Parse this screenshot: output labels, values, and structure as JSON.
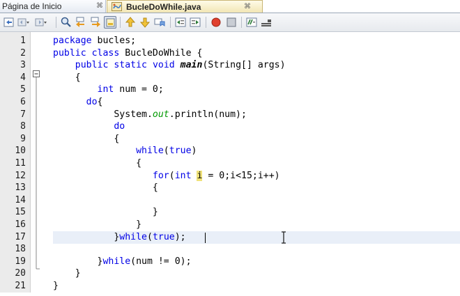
{
  "tabs": [
    {
      "label": "Página de Inicio",
      "active": false
    },
    {
      "label": "BucleDoWhile.java",
      "active": true
    }
  ],
  "tab_close_glyph": "⌘",
  "toolbar": {
    "icons": [
      "back-history-icon",
      "back-dropdown-icon",
      "forward-history-icon",
      "forward-dropdown-icon",
      "find-selection-icon",
      "find-previous-icon",
      "find-next-icon",
      "toggle-highlight-icon",
      "previous-bookmark-icon",
      "next-bookmark-icon",
      "toggle-bookmark-icon",
      "shift-left-icon",
      "shift-right-icon",
      "start-macro-icon",
      "stop-macro-icon",
      "comment-icon",
      "uncomment-icon"
    ]
  },
  "colors": {
    "keyword": "#0000e6",
    "field": "#009900",
    "occurrence_highlight": "#f0e27a",
    "current_line": "#e9eff8"
  },
  "editor": {
    "line_numbers": [
      "1",
      "2",
      "3",
      "4",
      "5",
      "6",
      "7",
      "8",
      "9",
      "10",
      "11",
      "12",
      "13",
      "14",
      "15",
      "16",
      "17",
      "18",
      "19",
      "20",
      "21"
    ],
    "current_line": 17,
    "lines": [
      "package bucles;",
      "public class BucleDoWhile {",
      "    public static void main(String[] args)",
      "    {",
      "        int num = 0;",
      "      do{",
      "           System.out.println(num);",
      "           do",
      "           {",
      "               while(true)",
      "               {",
      "                  for(int i = 0;i<15;i++)",
      "                  {",
      "",
      "                  }",
      "               }",
      "           }while(true);",
      "",
      "        }while(num != 0);",
      "    }",
      "}"
    ]
  }
}
